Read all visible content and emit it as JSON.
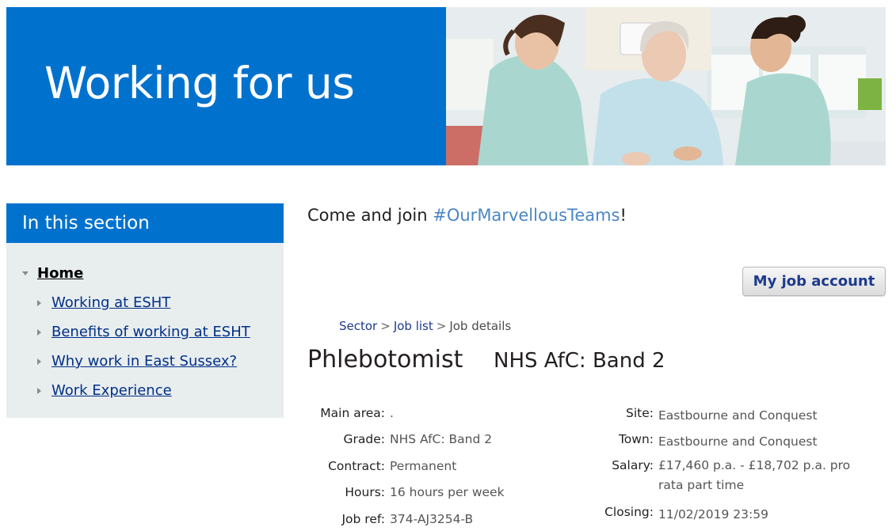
{
  "banner": {
    "title": "Working for us"
  },
  "sidebar": {
    "heading": "In this section",
    "items": [
      {
        "label": "Home",
        "level": "top",
        "expanded": true
      },
      {
        "label": "Working at ESHT",
        "level": "sub"
      },
      {
        "label": "Benefits of working at ESHT",
        "level": "sub"
      },
      {
        "label": "Why work in East Sussex?",
        "level": "sub"
      },
      {
        "label": "Work Experience",
        "level": "sub"
      }
    ]
  },
  "intro": {
    "prefix": "Come and join ",
    "hashtag": "#OurMarvellousTeams",
    "suffix": "!"
  },
  "account_button": "My job account",
  "breadcrumb": {
    "sector": "Sector",
    "sep": ">",
    "job_list": "Job list",
    "current": "Job details"
  },
  "job": {
    "title": "Phlebotomist",
    "band": "NHS AfC: Band 2",
    "details_left": [
      {
        "key": "Main area:",
        "value": "."
      },
      {
        "key": "Grade:",
        "value": "NHS AfC: Band 2"
      },
      {
        "key": "Contract:",
        "value": "Permanent"
      },
      {
        "key": "Hours:",
        "value": "16 hours per week"
      },
      {
        "key": "Job ref:",
        "value": "374-AJ3254-B"
      }
    ],
    "details_right": [
      {
        "key": "Site:",
        "value": "Eastbourne and Conquest"
      },
      {
        "key": "Town:",
        "value": "Eastbourne and Conquest"
      },
      {
        "key": "Salary:",
        "value": "£17,460 p.a. - £18,702 p.a. pro rata part time"
      },
      {
        "key": "Closing:",
        "value": "11/02/2019 23:59"
      }
    ]
  },
  "colors": {
    "brand_blue": "#0072ce",
    "link_blue": "#003087",
    "hashtag_blue": "#4a86c5",
    "sidebar_bg": "#e8edee"
  }
}
